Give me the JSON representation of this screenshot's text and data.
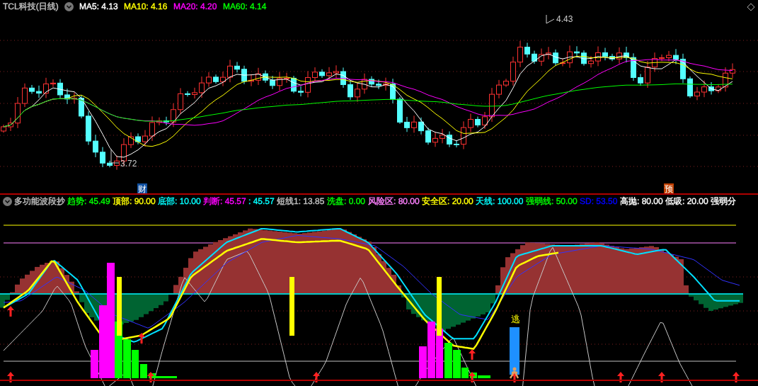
{
  "price_panel": {
    "title": "TCL科技(日线)",
    "indicators": [
      {
        "text": "MA5: 4.13",
        "color": "#ffffff"
      },
      {
        "text": "MA10: 4.16",
        "color": "#ffff00"
      },
      {
        "text": "MA20: 4.20",
        "color": "#ff00ff"
      },
      {
        "text": "MA60: 4.14",
        "color": "#00ff00"
      }
    ],
    "high_label": "4.43",
    "low_label": "3.72",
    "markers": [
      {
        "text": "财",
        "kind": "finance"
      },
      {
        "text": "预",
        "kind": "forecast"
      }
    ]
  },
  "indicator_panel": {
    "title": "多功能波段抄",
    "indicators": [
      {
        "text": "趋势: 45.49",
        "color": "#00ff00"
      },
      {
        "text": "顶部: 90.00",
        "color": "#ffff00"
      },
      {
        "text": "底部: 10.00",
        "color": "#00ffff"
      },
      {
        "text": "判断: 45.57",
        "color": "#ff00ff"
      },
      {
        "text": ": 45.57",
        "color": "#00ffff"
      },
      {
        "text": "短线1: 13.85",
        "color": "#c0c0c0"
      },
      {
        "text": "洗盘: 0.00",
        "color": "#00ff00"
      },
      {
        "text": "风险区: 80.00",
        "color": "#ff80ff"
      },
      {
        "text": "安全区: 20.00",
        "color": "#ffff00"
      },
      {
        "text": "天线: 100.00",
        "color": "#00ffff"
      },
      {
        "text": "强弱线: 50.00",
        "color": "#00ff00"
      },
      {
        "text": "SD: 53.50",
        "color": "#0000ff"
      },
      {
        "text": "高抛: 80.00",
        "color": "#ffffff"
      },
      {
        "text": "低吸: 20.00",
        "color": "#ffffff"
      },
      {
        "text": "强弱分",
        "color": "#ffffff"
      }
    ],
    "escape_label": "逃"
  }
}
